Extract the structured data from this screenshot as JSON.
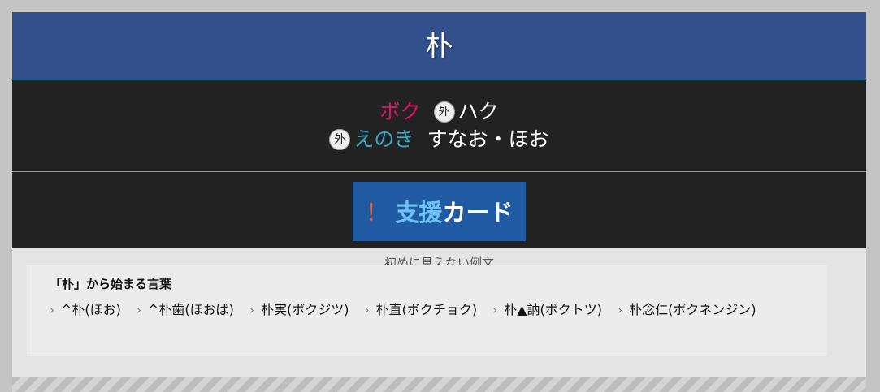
{
  "header": {
    "kanji": "朴"
  },
  "readings": {
    "line1": {
      "on": "ボク",
      "badge": "外",
      "extra": "ハク"
    },
    "line2": {
      "badge": "外",
      "kun": "えのき",
      "nanori": "すなお・ほお"
    }
  },
  "support": {
    "exclaim": "！",
    "blue": "支援",
    "white": "カード"
  },
  "hidden_note": "初めに見えない例文",
  "words": {
    "title": "「朴」から始まる言葉",
    "items": [
      "^朴(ほお)",
      "^朴歯(ほおば)",
      "朴実(ボクジツ)",
      "朴直(ボクチョク)",
      "朴▲訥(ボクトツ)",
      "朴念仁(ボクネンジン)"
    ],
    "chevron": "›"
  }
}
